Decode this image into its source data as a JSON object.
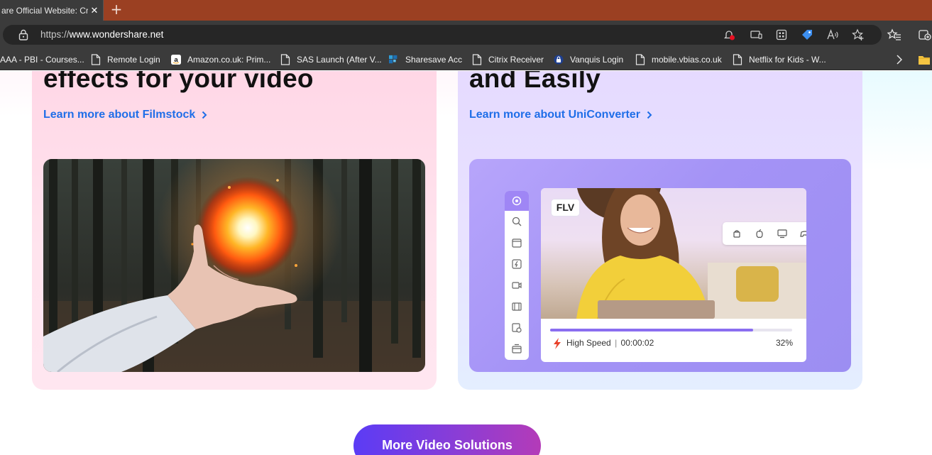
{
  "browser": {
    "tab": {
      "title": "are Official Website: Cr",
      "close": "✕"
    },
    "new_tab": "+",
    "address": {
      "scheme": "https://",
      "host": "www.wondershare.net"
    },
    "bookmarks": [
      {
        "label": "AAA - PBI - Courses..."
      },
      {
        "label": "Remote Login"
      },
      {
        "label": "Amazon.co.uk: Prim..."
      },
      {
        "label": "SAS Launch (After V..."
      },
      {
        "label": "Sharesave Acc"
      },
      {
        "label": "Citrix Receiver"
      },
      {
        "label": "Vanquis Login"
      },
      {
        "label": "mobile.vbias.co.uk"
      },
      {
        "label": "Netflix for Kids - W..."
      }
    ]
  },
  "cards": {
    "filmstock": {
      "title": "effects for your video",
      "link": "Learn more about Filmstock",
      "media_icon": "fireball-hand-image"
    },
    "uniconverter": {
      "title": "and Easily",
      "link": "Learn more about UniConverter",
      "mock": {
        "format_badge": "FLV",
        "speed_label": "High Speed",
        "separator": "|",
        "time": "00:00:02",
        "percent": "32%",
        "progress": 0.84
      }
    }
  },
  "cta": {
    "label": "More Video Solutions"
  },
  "colors": {
    "link_blue": "#1f6ee8",
    "tabstrip": "#9b4022",
    "cta_start": "#5b3cf5",
    "cta_end": "#b43bb8",
    "progress": "#8a6ef0"
  }
}
